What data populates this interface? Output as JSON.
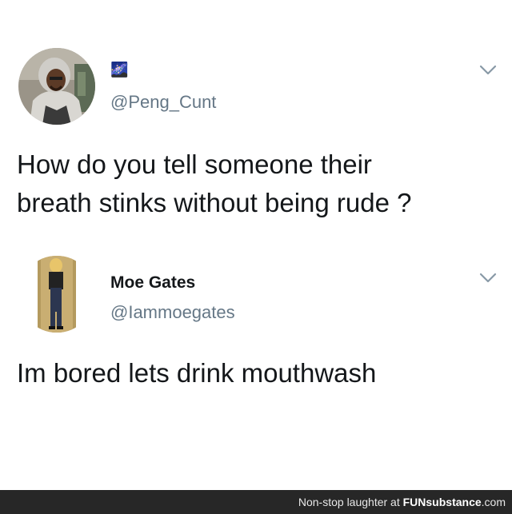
{
  "tweet": {
    "display_name": "🌌",
    "handle": "@Peng_Cunt",
    "text_line1": "How do you tell someone their",
    "text_line2": "breath stinks without being rude ?",
    "avatar_icon": "user-avatar"
  },
  "reply": {
    "display_name": "Moe Gates",
    "handle": "@Iammoegates",
    "text": "Im bored lets drink mouthwash",
    "avatar_icon": "user-avatar"
  },
  "footer": {
    "prefix": "Non-stop laughter at ",
    "brand": "FUNsubstance",
    "suffix": ".com"
  },
  "colors": {
    "text": "#14171a",
    "secondary": "#657786",
    "footer_bg": "#272727"
  }
}
